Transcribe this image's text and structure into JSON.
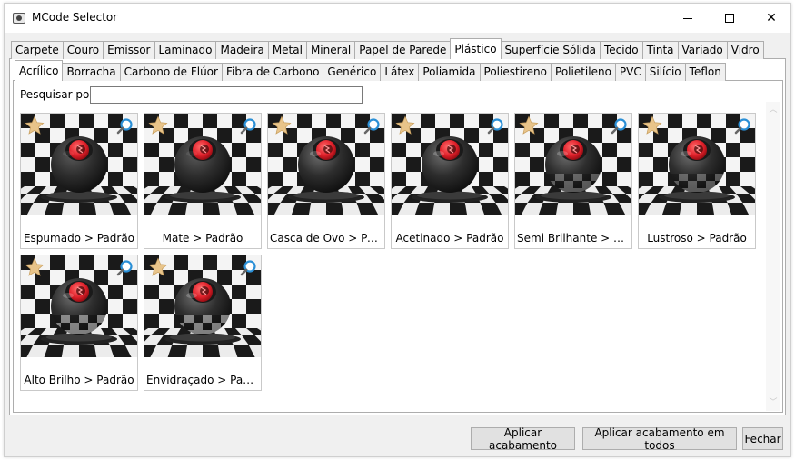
{
  "window": {
    "title": "MCode Selector"
  },
  "categories": [
    {
      "label": "Carpete"
    },
    {
      "label": "Couro"
    },
    {
      "label": "Emissor"
    },
    {
      "label": "Laminado"
    },
    {
      "label": "Madeira"
    },
    {
      "label": "Metal"
    },
    {
      "label": "Mineral"
    },
    {
      "label": "Papel de Parede"
    },
    {
      "label": "Plástico",
      "active": true
    },
    {
      "label": "Superfície Sólida"
    },
    {
      "label": "Tecido"
    },
    {
      "label": "Tinta"
    },
    {
      "label": "Variado"
    },
    {
      "label": "Vidro"
    }
  ],
  "subcategories": [
    {
      "label": "Acrílico",
      "active": true
    },
    {
      "label": "Borracha"
    },
    {
      "label": "Carbono de Flúor"
    },
    {
      "label": "Fibra de Carbono"
    },
    {
      "label": "Genérico"
    },
    {
      "label": "Látex"
    },
    {
      "label": "Poliamida"
    },
    {
      "label": "Poliestireno"
    },
    {
      "label": "Polietileno"
    },
    {
      "label": "PVC"
    },
    {
      "label": "Silício"
    },
    {
      "label": "Teflon"
    }
  ],
  "search": {
    "label": "Pesquisar por:",
    "value": "",
    "placeholder": ""
  },
  "materials": [
    {
      "label": "Espumado > Padrão",
      "finish": "matte"
    },
    {
      "label": "Mate > Padrão",
      "finish": "matte"
    },
    {
      "label": "Casca de Ovo > Padr...",
      "finish": "satin"
    },
    {
      "label": "Acetinado > Padrão",
      "finish": "satin"
    },
    {
      "label": "Semi Brilhante > Pad...",
      "finish": "gloss"
    },
    {
      "label": "Lustroso > Padrão",
      "finish": "gloss"
    },
    {
      "label": "Alto Brilho > Padrão",
      "finish": "glossy"
    },
    {
      "label": "Envidraçado > Padrão",
      "finish": "glossy"
    }
  ],
  "buttons": {
    "apply": "Aplicar acabamento",
    "apply_all": "Aplicar acabamento em todos",
    "close": "Fechar"
  },
  "icons": {
    "favorite": "star-icon",
    "preview": "magnifier-icon",
    "star_color": "#e8c48a",
    "magnifier_color": "#2a8fd6",
    "accent_red": "#e0202a"
  }
}
